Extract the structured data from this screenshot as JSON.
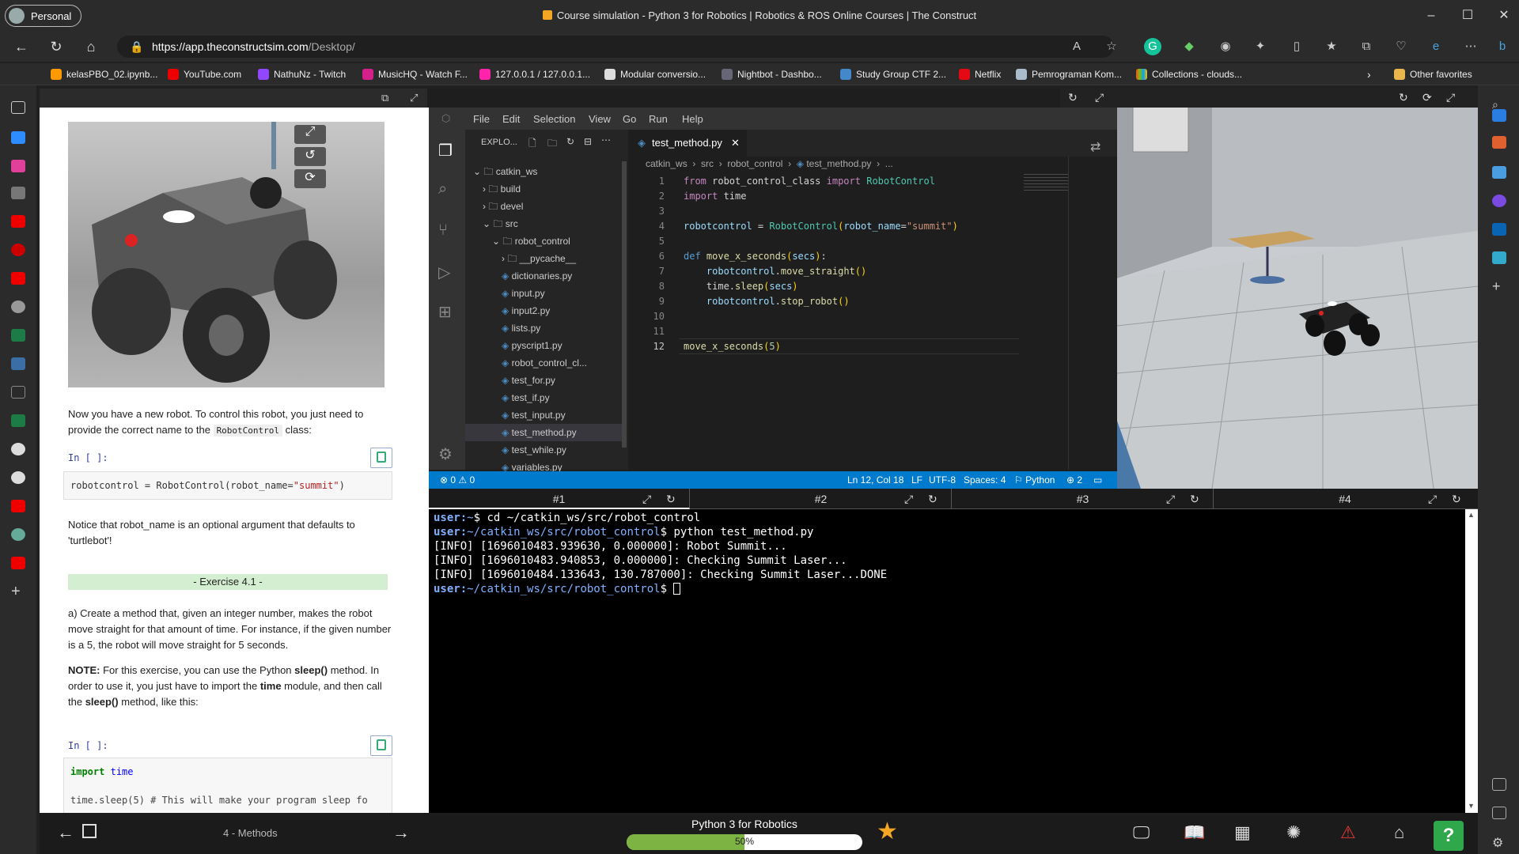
{
  "browser": {
    "profile": "Personal",
    "title": "Course simulation - Python 3 for Robotics | Robotics & ROS Online Courses | The Construct",
    "url_host": "https://app.theconstructsim.com",
    "url_path": "/Desktop/"
  },
  "favorites": [
    "kelasPBO_02.ipynb...",
    "YouTube.com",
    "NathuNz - Twitch",
    "MusicHQ - Watch F...",
    "127.0.0.1 / 127.0.0.1...",
    "Modular conversio...",
    "Nightbot - Dashbo...",
    "Study Group CTF 2...",
    "Netflix",
    "Pemrograman Kom...",
    "Collections - clouds..."
  ],
  "other_favorites": "Other favorites",
  "notebook": {
    "p1": "Now you have a new robot. To control this robot, you just need to provide the correct name to the",
    "p1_code": "RobotControl",
    "p1_end": "class:",
    "in_label": "In [ ]:",
    "cell1_a": "robotcontrol = RobotControl(robot_name=",
    "cell1_str": "\"summit\"",
    "cell1_b": ")",
    "p2": "Notice that robot_name is an optional argument that defaults to 'turtlebot'!",
    "exercise": "- Exercise 4.1 -",
    "p3": "a) Create a method that, given an integer number, makes the robot move straight for that amount of time. For instance, if the given number is a 5, the robot will move straight for 5 seconds.",
    "note_label": "NOTE:",
    "note_a": "For this exercise, you can use the Python",
    "note_sleep": "sleep()",
    "note_b": "method. In order to use it, you just have to import the",
    "note_time": "time",
    "note_c": "module, and then call the",
    "note_sleep2": "sleep()",
    "note_d": "method, like this:",
    "in_label2": "In [ ]:",
    "cell2_kw": "import",
    "cell2_mod": "time",
    "cell2_line2": "time.sleep(5) # This will make your program sleep fo"
  },
  "vscode": {
    "menu": [
      "File",
      "Edit",
      "Selection",
      "View",
      "Go",
      "Run",
      "Help"
    ],
    "explorer_title": "EXPLO...",
    "tree": [
      {
        "label": "catkin_ws",
        "indent": 0,
        "type": "folder-open"
      },
      {
        "label": "build",
        "indent": 1,
        "type": "folder"
      },
      {
        "label": "devel",
        "indent": 1,
        "type": "folder"
      },
      {
        "label": "src",
        "indent": 1,
        "type": "folder-open"
      },
      {
        "label": "robot_control",
        "indent": 2,
        "type": "folder-open"
      },
      {
        "label": "__pycache__",
        "indent": 3,
        "type": "folder"
      },
      {
        "label": "dictionaries.py",
        "indent": 3,
        "type": "file"
      },
      {
        "label": "input.py",
        "indent": 3,
        "type": "file"
      },
      {
        "label": "input2.py",
        "indent": 3,
        "type": "file"
      },
      {
        "label": "lists.py",
        "indent": 3,
        "type": "file"
      },
      {
        "label": "pyscript1.py",
        "indent": 3,
        "type": "file"
      },
      {
        "label": "robot_control_cl...",
        "indent": 3,
        "type": "file"
      },
      {
        "label": "test_for.py",
        "indent": 3,
        "type": "file"
      },
      {
        "label": "test_if.py",
        "indent": 3,
        "type": "file"
      },
      {
        "label": "test_input.py",
        "indent": 3,
        "type": "file"
      },
      {
        "label": "test_method.py",
        "indent": 3,
        "type": "file",
        "selected": true
      },
      {
        "label": "test_while.py",
        "indent": 3,
        "type": "file"
      },
      {
        "label": "variables.py",
        "indent": 3,
        "type": "file"
      }
    ],
    "tab": "test_method.py",
    "breadcrumb": [
      "catkin_ws",
      "src",
      "robot_control",
      "test_method.py",
      "..."
    ],
    "status": {
      "problems": "0",
      "warnings": "0",
      "position": "Ln 12, Col 18",
      "eol": "LF",
      "encoding": "UTF-8",
      "spaces": "Spaces: 4",
      "lang": "Python",
      "notif": "2"
    }
  },
  "terminal": {
    "tabs": [
      "#1",
      "#2",
      "#3",
      "#4"
    ],
    "prompt_user": "user:",
    "lines": [
      {
        "path": "~",
        "cmd": "cd ~/catkin_ws/src/robot_control"
      },
      {
        "path": "~/catkin_ws/src/robot_control",
        "cmd": "python test_method.py"
      }
    ],
    "out": [
      "[INFO] [1696010483.939630, 0.000000]: Robot Summit...",
      "[INFO] [1696010483.940853, 0.000000]: Checking Summit Laser...",
      "[INFO] [1696010484.133643, 130.787000]: Checking Summit Laser...DONE"
    ],
    "last_path": "~/catkin_ws/src/robot_control"
  },
  "bottom": {
    "unit": "4 - Methods",
    "course": "Python 3 for Robotics",
    "progress_label": "50%",
    "progress": 0.5
  }
}
